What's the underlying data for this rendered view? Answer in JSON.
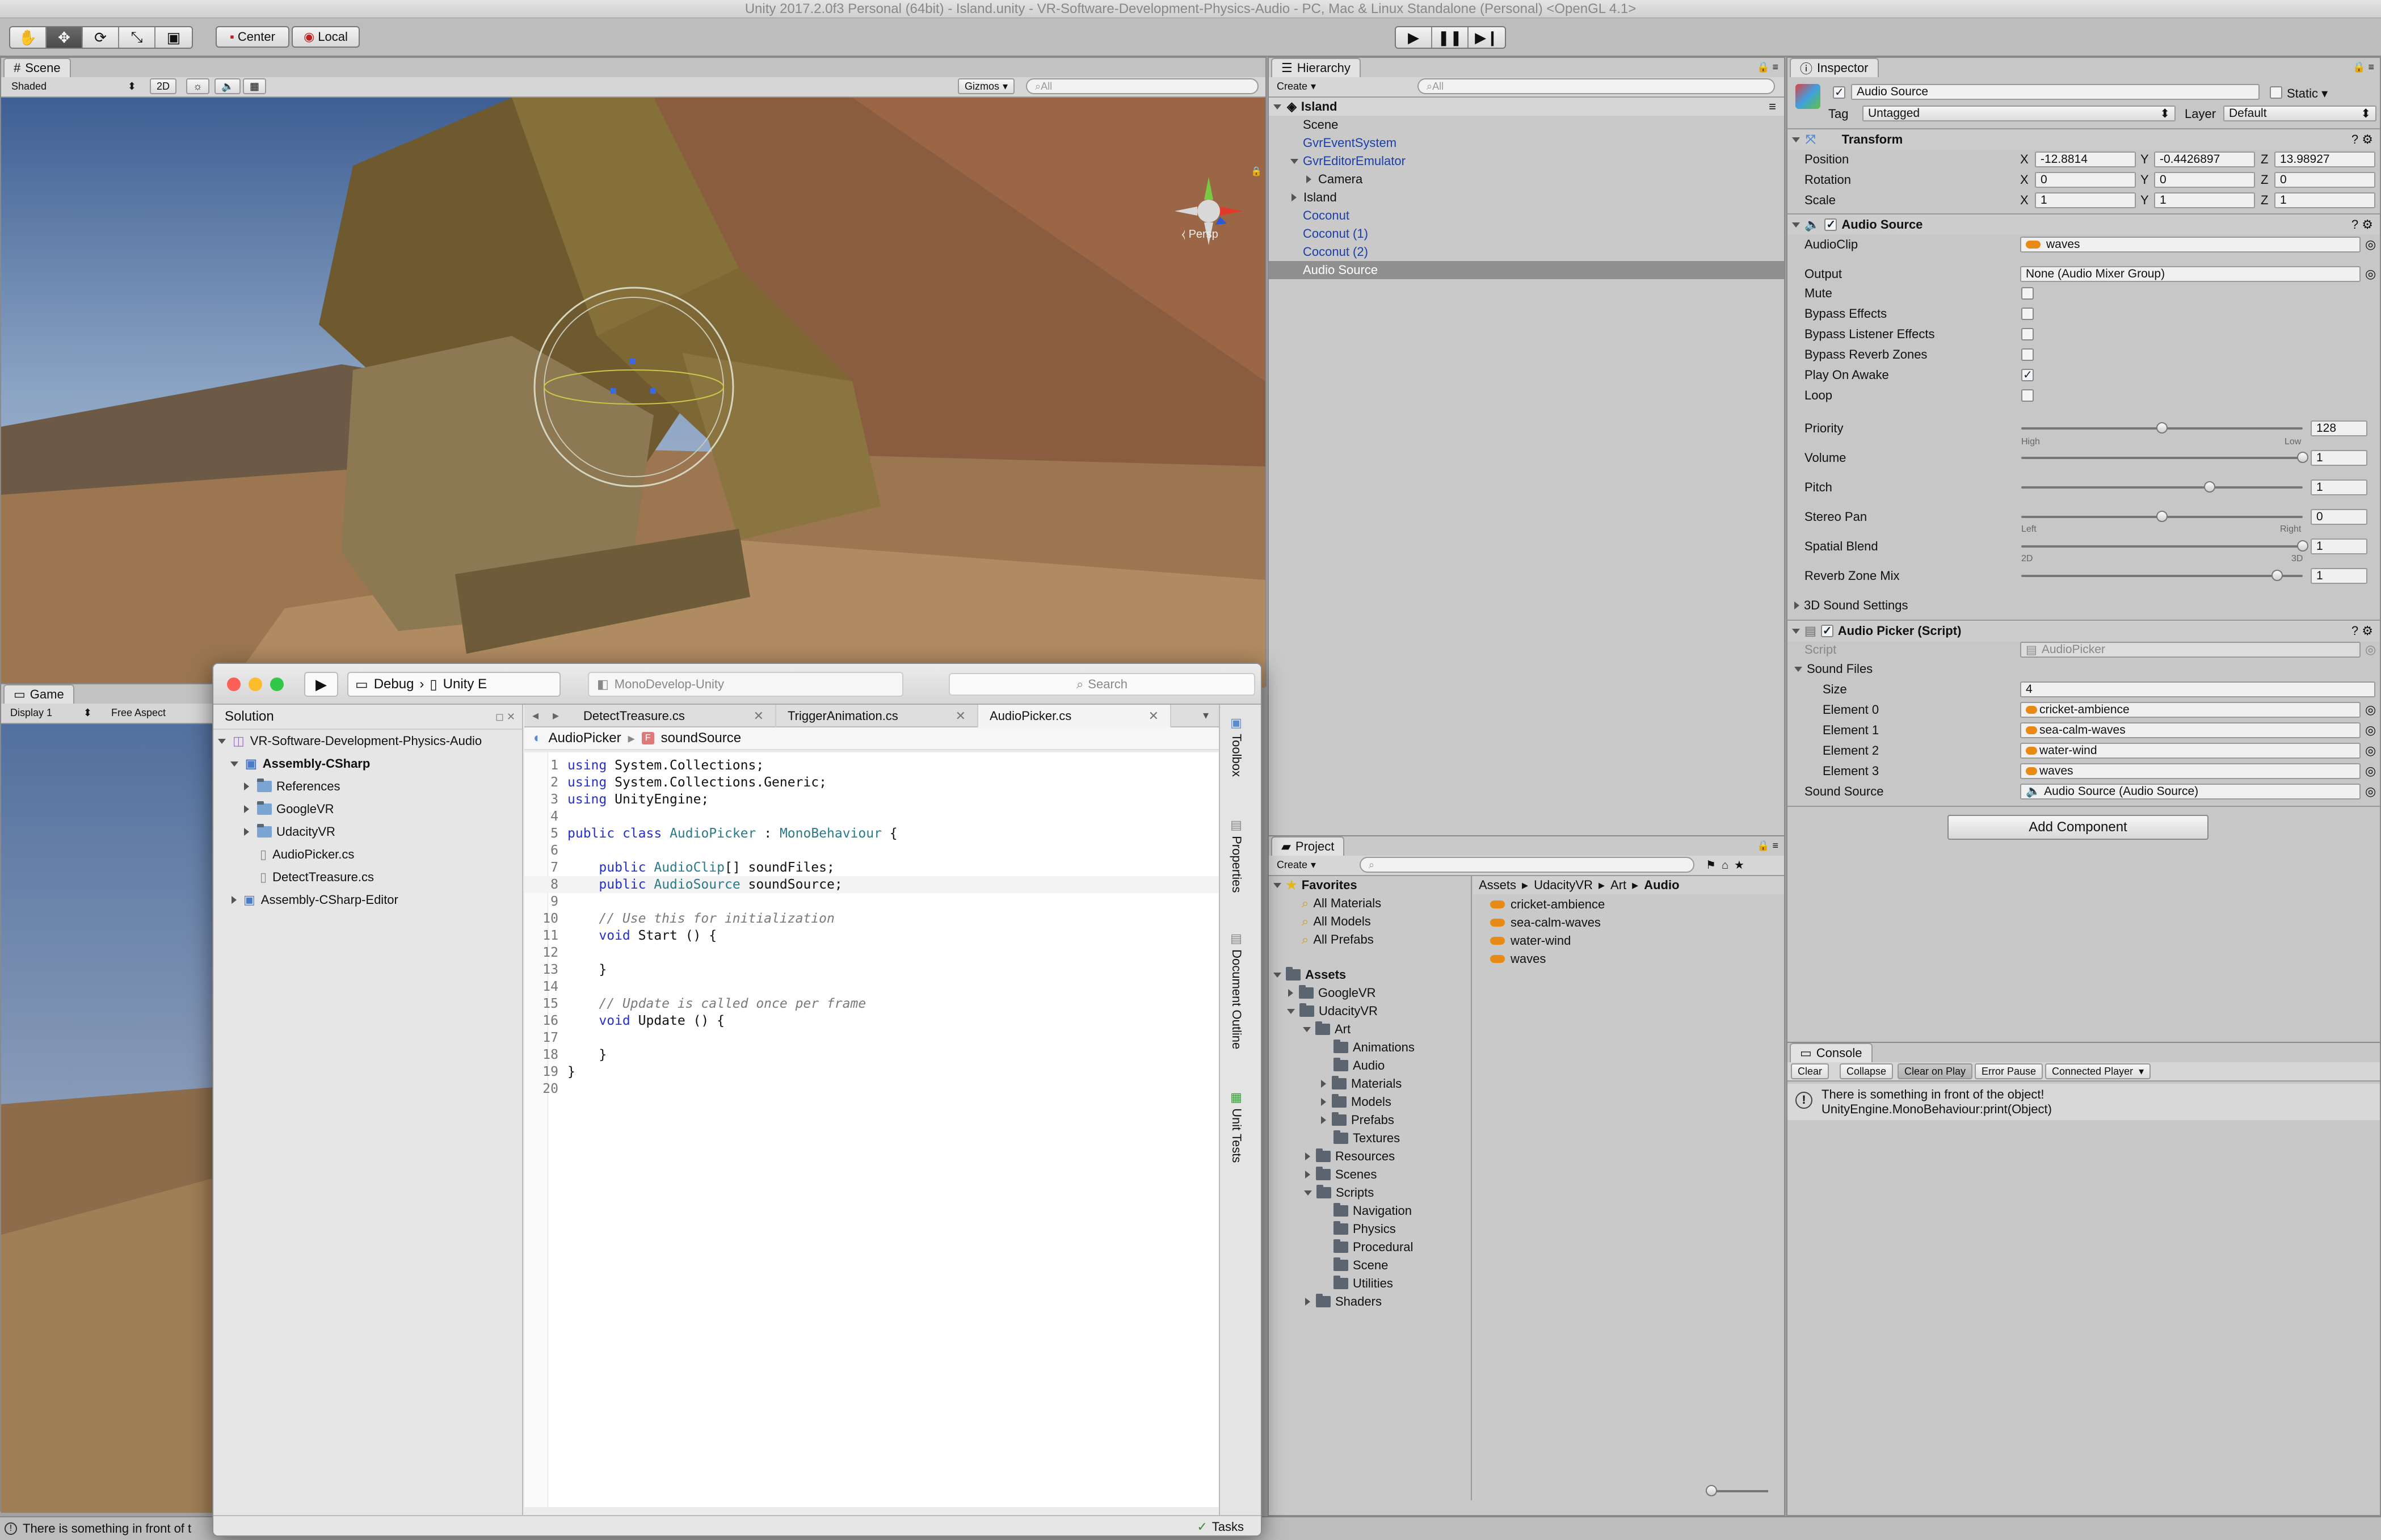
{
  "window": {
    "title": "Unity 2017.2.0f3 Personal (64bit) - Island.unity - VR-Software-Development-Physics-Audio - PC, Mac & Linux Standalone (Personal) <OpenGL 4.1>"
  },
  "toolbar": {
    "pivot": "Center",
    "space": "Local"
  },
  "scene": {
    "tab": "Scene",
    "shading": "Shaded",
    "mode2d": "2D",
    "gizmos": "Gizmos",
    "search_placeholder": "All",
    "persp": "Persp"
  },
  "game": {
    "tab": "Game",
    "display": "Display 1",
    "aspect": "Free Aspect"
  },
  "status_bar": {
    "message": "There is something in front of t"
  },
  "hierarchy": {
    "tab": "Hierarchy",
    "create": "Create",
    "search_placeholder": "All",
    "root": "Island",
    "items": [
      {
        "label": "Scene"
      },
      {
        "label": "GvrEventSystem"
      },
      {
        "label": "GvrEditorEmulator"
      },
      {
        "label": "Camera"
      },
      {
        "label": "Island"
      },
      {
        "label": "Coconut"
      },
      {
        "label": "Coconut (1)"
      },
      {
        "label": "Coconut (2)"
      },
      {
        "label": "Audio Source"
      }
    ]
  },
  "inspector": {
    "tab": "Inspector",
    "object_name": "Audio Source",
    "static_label": "Static",
    "tag_label": "Tag",
    "tag_value": "Untagged",
    "layer_label": "Layer",
    "layer_value": "Default",
    "transform": {
      "title": "Transform",
      "position_label": "Position",
      "position": {
        "x": "-12.8814",
        "y": "-0.4426897",
        "z": "13.98927"
      },
      "rotation_label": "Rotation",
      "rotation": {
        "x": "0",
        "y": "0",
        "z": "0"
      },
      "scale_label": "Scale",
      "scale": {
        "x": "1",
        "y": "1",
        "z": "1"
      },
      "x": "X",
      "y": "Y",
      "z": "Z"
    },
    "audio_source": {
      "title": "Audio Source",
      "audioclip_label": "AudioClip",
      "audioclip": "waves",
      "output_label": "Output",
      "output": "None (Audio Mixer Group)",
      "mute": "Mute",
      "bypass_effects": "Bypass Effects",
      "bypass_listener": "Bypass Listener Effects",
      "bypass_reverb": "Bypass Reverb Zones",
      "play_on_awake": "Play On Awake",
      "loop": "Loop",
      "priority_label": "Priority",
      "priority": "128",
      "priority_value": 0.5,
      "high": "High",
      "low": "Low",
      "volume_label": "Volume",
      "volume": "1",
      "volume_value": 1.0,
      "pitch_label": "Pitch",
      "pitch": "1",
      "pitch_value": 0.67,
      "stereo_label": "Stereo Pan",
      "stereo": "0",
      "stereo_value": 0.5,
      "left": "Left",
      "right": "Right",
      "spatial_label": "Spatial Blend",
      "spatial": "1",
      "spatial_value": 1.0,
      "d2": "2D",
      "d3": "3D",
      "reverb_label": "Reverb Zone Mix",
      "reverb": "1",
      "reverb_value": 0.91,
      "sound3d": "3D Sound Settings"
    },
    "audio_picker": {
      "title": "Audio Picker (Script)",
      "script_label": "Script",
      "script": "AudioPicker",
      "sound_files": "Sound Files",
      "size_label": "Size",
      "size": "4",
      "elements": [
        {
          "label": "Element 0",
          "value": "cricket-ambience"
        },
        {
          "label": "Element 1",
          "value": "sea-calm-waves"
        },
        {
          "label": "Element 2",
          "value": "water-wind"
        },
        {
          "label": "Element 3",
          "value": "waves"
        }
      ],
      "sound_source_label": "Sound Source",
      "sound_source": "Audio Source (Audio Source)"
    },
    "add_component": "Add Component"
  },
  "project": {
    "tab": "Project",
    "create": "Create",
    "favorites": "Favorites",
    "fav_items": [
      "All Materials",
      "All Models",
      "All Prefabs"
    ],
    "assets": "Assets",
    "tree": [
      {
        "label": "GoogleVR",
        "depth": 1
      },
      {
        "label": "UdacityVR",
        "depth": 1
      },
      {
        "label": "Art",
        "depth": 2
      },
      {
        "label": "Animations",
        "depth": 3
      },
      {
        "label": "Audio",
        "depth": 3
      },
      {
        "label": "Materials",
        "depth": 3
      },
      {
        "label": "Models",
        "depth": 3
      },
      {
        "label": "Prefabs",
        "depth": 3
      },
      {
        "label": "Textures",
        "depth": 3
      },
      {
        "label": "Resources",
        "depth": 2
      },
      {
        "label": "Scenes",
        "depth": 2
      },
      {
        "label": "Scripts",
        "depth": 2
      },
      {
        "label": "Navigation",
        "depth": 3
      },
      {
        "label": "Physics",
        "depth": 3
      },
      {
        "label": "Procedural",
        "depth": 3
      },
      {
        "label": "Scene",
        "depth": 3
      },
      {
        "label": "Utilities",
        "depth": 3
      },
      {
        "label": "Shaders",
        "depth": 2
      }
    ],
    "breadcrumb": [
      "Assets",
      "UdacityVR",
      "Art",
      "Audio"
    ],
    "files": [
      "cricket-ambience",
      "sea-calm-waves",
      "water-wind",
      "waves"
    ]
  },
  "console": {
    "tab": "Console",
    "buttons": [
      "Clear",
      "Collapse",
      "Clear on Play",
      "Error Pause",
      "Connected Player"
    ],
    "message_line1": "There is something in front of the object!",
    "message_line2": "UnityEngine.MonoBehaviour:print(Object)"
  },
  "monodevelop": {
    "config": "Debug",
    "target": "Unity E",
    "app_title": "MonoDevelop-Unity",
    "search_placeholder": "Search",
    "solution_label": "Solution",
    "solution_tree": [
      {
        "label": "VR-Software-Development-Physics-Audio",
        "depth": 0,
        "bold": false
      },
      {
        "label": "Assembly-CSharp",
        "depth": 1,
        "bold": true
      },
      {
        "label": "References",
        "depth": 2,
        "bold": false
      },
      {
        "label": "GoogleVR",
        "depth": 2,
        "bold": false
      },
      {
        "label": "UdacityVR",
        "depth": 2,
        "bold": false
      },
      {
        "label": "AudioPicker.cs",
        "depth": 2,
        "bold": false
      },
      {
        "label": "DetectTreasure.cs",
        "depth": 2,
        "bold": false
      },
      {
        "label": "Assembly-CSharp-Editor",
        "depth": 1,
        "bold": false
      }
    ],
    "tabs": [
      "DetectTreasure.cs",
      "TriggerAnimation.cs",
      "AudioPicker.cs"
    ],
    "path_class": "AudioPicker",
    "path_member": "soundSource",
    "side_tabs": [
      "Toolbox",
      "Properties",
      "Document Outline",
      "Unit Tests"
    ],
    "tasks": "Tasks",
    "code": [
      "using System.Collections;",
      "using System.Collections.Generic;",
      "using UnityEngine;",
      "",
      "public class AudioPicker : MonoBehaviour {",
      "",
      "    public AudioClip[] soundFiles;",
      "    public AudioSource soundSource;",
      "",
      "    // Use this for initialization",
      "    void Start () {",
      "",
      "    }",
      "",
      "    // Update is called once per frame",
      "    void Update () {",
      "",
      "    }",
      "}",
      ""
    ]
  },
  "colors": {
    "selection": "#8f8f8f",
    "link_blue": "#1b3fa6",
    "audio_orange": "#e88a14"
  }
}
